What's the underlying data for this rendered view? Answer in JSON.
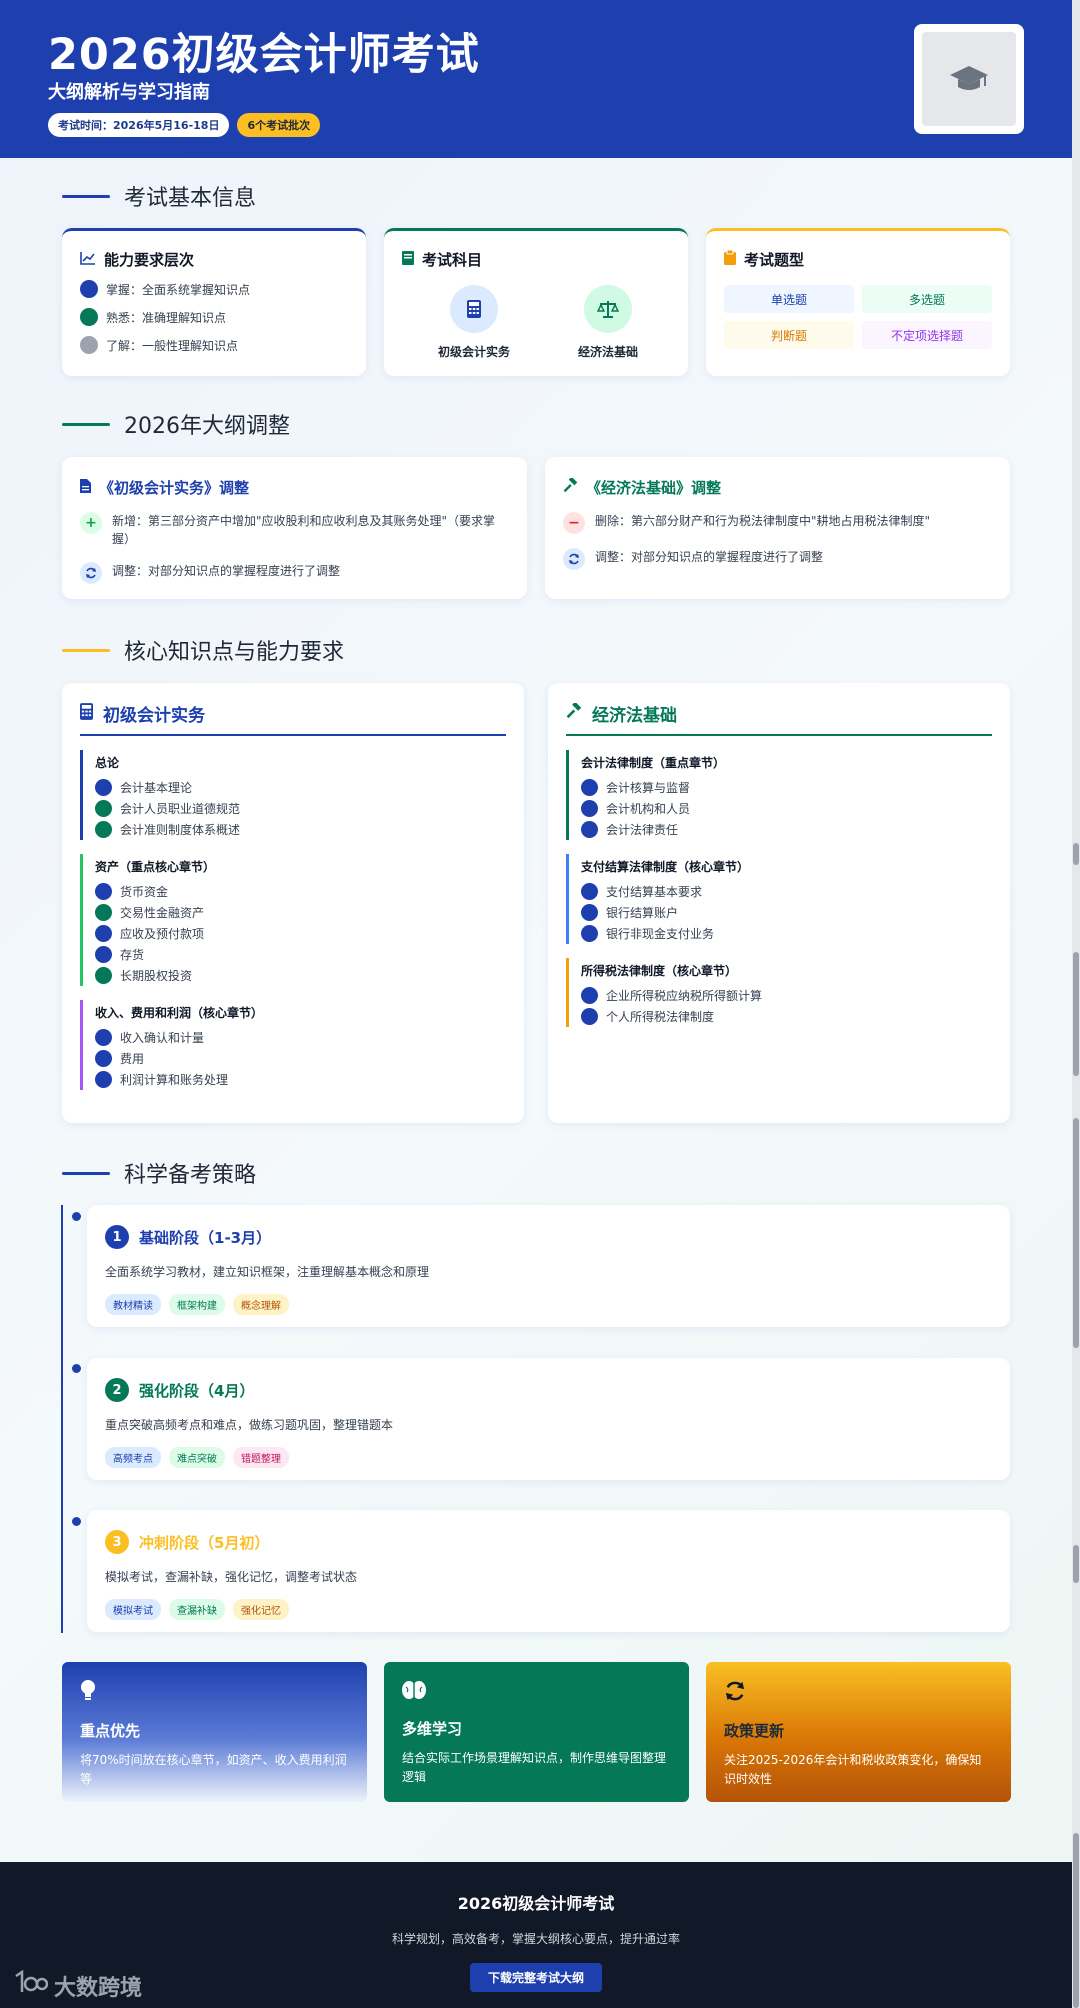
{
  "header": {
    "title": "2026初级会计师考试",
    "subtitle": "大纲解析与学习指南",
    "exam_time": "考试时间：2026年5月16-18日",
    "batches": "6个考试批次",
    "logo_icon": "graduation-cap-icon"
  },
  "section_basic": {
    "title": "考试基本信息",
    "ability": {
      "title": "能力要求层次",
      "icon": "chart-line-icon",
      "levels": [
        {
          "text": "掌握：全面系统掌握知识点",
          "color": "#1e40af"
        },
        {
          "text": "熟悉：准确理解知识点",
          "color": "#047857"
        },
        {
          "text": "了解：一般性理解知识点",
          "color": "#9ca3af"
        }
      ]
    },
    "subjects": {
      "title": "考试科目",
      "icon": "book-icon",
      "items": [
        {
          "label": "初级会计实务",
          "icon": "calculator-icon"
        },
        {
          "label": "经济法基础",
          "icon": "scale-icon"
        }
      ]
    },
    "types": {
      "title": "考试题型",
      "icon": "clipboard-icon",
      "items": [
        "单选题",
        "多选题",
        "判断题",
        "不定项选择题"
      ]
    }
  },
  "section_adjust": {
    "title": "2026年大纲调整",
    "practice": {
      "title": "《初级会计实务》调整",
      "icon": "file-icon",
      "rows": [
        {
          "icon": "plus-icon",
          "text": "新增：第三部分资产中增加\"应收股利和应收利息及其账务处理\"（要求掌握）"
        },
        {
          "icon": "sync-icon",
          "text": "调整：对部分知识点的掌握程度进行了调整"
        }
      ]
    },
    "law": {
      "title": "《经济法基础》调整",
      "icon": "gavel-icon",
      "rows": [
        {
          "icon": "minus-icon",
          "text": "删除：第六部分财产和行为税法律制度中\"耕地占用税法律制度\""
        },
        {
          "icon": "sync-icon",
          "text": "调整：对部分知识点的掌握程度进行了调整"
        }
      ]
    }
  },
  "section_core": {
    "title": "核心知识点与能力要求",
    "practice": {
      "title": "初级会计实务",
      "icon": "calculator-icon",
      "groups": [
        {
          "title": "总论",
          "border": "#1e40af",
          "items": [
            {
              "text": "会计基本理论",
              "color": "#1e40af"
            },
            {
              "text": "会计人员职业道德规范",
              "color": "#047857"
            },
            {
              "text": "会计准则制度体系概述",
              "color": "#047857"
            }
          ]
        },
        {
          "title": "资产（重点核心章节）",
          "border": "#22c55e",
          "items": [
            {
              "text": "货币资金",
              "color": "#1e40af"
            },
            {
              "text": "交易性金融资产",
              "color": "#047857"
            },
            {
              "text": "应收及预付款项",
              "color": "#1e40af"
            },
            {
              "text": "存货",
              "color": "#1e40af"
            },
            {
              "text": "长期股权投资",
              "color": "#047857"
            }
          ]
        },
        {
          "title": "收入、费用和利润（核心章节）",
          "border": "#a855f7",
          "items": [
            {
              "text": "收入确认和计量",
              "color": "#1e40af"
            },
            {
              "text": "费用",
              "color": "#1e40af"
            },
            {
              "text": "利润计算和账务处理",
              "color": "#1e40af"
            }
          ]
        }
      ]
    },
    "law": {
      "title": "经济法基础",
      "icon": "gavel-icon",
      "groups": [
        {
          "title": "会计法律制度（重点章节）",
          "border": "#047857",
          "items": [
            {
              "text": "会计核算与监督",
              "color": "#1e40af"
            },
            {
              "text": "会计机构和人员",
              "color": "#1e40af"
            },
            {
              "text": "会计法律责任",
              "color": "#1e40af"
            }
          ]
        },
        {
          "title": "支付结算法律制度（核心章节）",
          "border": "#3b82f6",
          "items": [
            {
              "text": "支付结算基本要求",
              "color": "#1e40af"
            },
            {
              "text": "银行结算账户",
              "color": "#1e40af"
            },
            {
              "text": "银行非现金支付业务",
              "color": "#1e40af"
            }
          ]
        },
        {
          "title": "所得税法律制度（核心章节）",
          "border": "#f59e0b",
          "items": [
            {
              "text": "企业所得税应纳税所得额计算",
              "color": "#1e40af"
            },
            {
              "text": "个人所得税法律制度",
              "color": "#1e40af"
            }
          ]
        }
      ]
    }
  },
  "section_strategy": {
    "title": "科学备考策略",
    "stages": [
      {
        "num": "1",
        "title": "基础阶段（1-3月）",
        "color": "#1e40af",
        "desc": "全面系统学习教材，建立知识框架，注重理解基本概念和原理",
        "tags": [
          "教材精读",
          "框架构建",
          "概念理解"
        ]
      },
      {
        "num": "2",
        "title": "强化阶段（4月）",
        "color": "#047857",
        "desc": "重点突破高频考点和难点，做练习题巩固，整理错题本",
        "tags": [
          "高频考点",
          "难点突破",
          "错题整理"
        ]
      },
      {
        "num": "3",
        "title": "冲刺阶段（5月初）",
        "color": "#fbbf24",
        "desc": "模拟考试，查漏补缺，强化记忆，调整考试状态",
        "tags": [
          "模拟考试",
          "查漏补缺",
          "强化记忆"
        ]
      }
    ]
  },
  "tips": [
    {
      "icon": "lightbulb-icon",
      "title": "重点优先",
      "desc": "将70%时间放在核心章节，如资产、收入费用利润等"
    },
    {
      "icon": "brain-icon",
      "title": "多维学习",
      "desc": "结合实际工作场景理解知识点，制作思维导图整理逻辑"
    },
    {
      "icon": "refresh-icon",
      "title": "政策更新",
      "desc": "关注2025-2026年会计和税收政策变化，确保知识时效性"
    }
  ],
  "footer": {
    "title": "2026初级会计师考试",
    "subtitle": "科学规划，高效备考，掌握大纲核心要点，提升通过率",
    "button": "下载完整考试大纲"
  },
  "watermark": "大数跨境"
}
